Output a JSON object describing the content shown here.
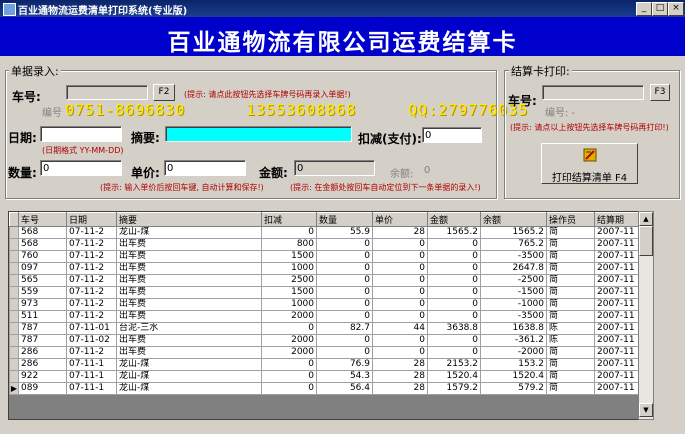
{
  "window": {
    "title": "百业通物流运费清单打印系统(专业版)",
    "controls": [
      "_",
      "□",
      "×"
    ]
  },
  "banner": {
    "heading": "百业通物流有限公司运费结算卡"
  },
  "entry": {
    "legend": "单据录入:",
    "plate_label": "车号:",
    "plate_value": "",
    "f2_button": "F2",
    "plate_hint": "(提示: 请点此按钮先选择车牌号码再录入单据!)",
    "serial_label": "编号",
    "date_label": "日期:",
    "date_value": "",
    "date_format": "(日期格式 YY-MM-DD)",
    "summary_label": "摘要:",
    "summary_value": "",
    "deduct_label": "扣减(支付):",
    "deduct_value": "0",
    "qty_label": "数量:",
    "qty_value": "0",
    "price_label": "单价:",
    "price_value": "0",
    "amount_label": "金额:",
    "amount_value": "0",
    "balance_label": "余额:",
    "balance_value": "0",
    "hint_enter": "(提示: 输入单价后按回车键, 自动计算和保存!)",
    "hint_cursor": "(提示: 在金额处按回车自动定位到下一条单据的录入!)"
  },
  "watermark": {
    "phone": "0751-8696830",
    "mobile": "13553608868",
    "qq": "QQ:279776035"
  },
  "print": {
    "legend": "结算卡打印:",
    "plate_label": "车号:",
    "plate_value": "",
    "f3_button": "F3",
    "serial_label": "编号: -",
    "hint": "(提示: 请点以上按钮先选择车牌号码再打印!)",
    "button_label": "打印结算清单 F4"
  },
  "table": {
    "columns": [
      "车号",
      "日期",
      "摘要",
      "扣减",
      "数量",
      "单价",
      "金额",
      "余额",
      "操作员",
      "结算期"
    ],
    "rows": [
      [
        "568",
        "07-11-2",
        "龙山-煤",
        "0",
        "55.9",
        "28",
        "1565.2",
        "1565.2",
        "简",
        "2007-11"
      ],
      [
        "568",
        "07-11-2",
        "出车费",
        "800",
        "0",
        "0",
        "0",
        "765.2",
        "简",
        "2007-11"
      ],
      [
        "760",
        "07-11-2",
        "出车费",
        "1500",
        "0",
        "0",
        "0",
        "-3500",
        "简",
        "2007-11"
      ],
      [
        "097",
        "07-11-2",
        "出车费",
        "1000",
        "0",
        "0",
        "0",
        "2647.8",
        "简",
        "2007-11"
      ],
      [
        "565",
        "07-11-2",
        "出车费",
        "2500",
        "0",
        "0",
        "0",
        "-2500",
        "简",
        "2007-11"
      ],
      [
        "559",
        "07-11-2",
        "出车费",
        "1500",
        "0",
        "0",
        "0",
        "-1500",
        "简",
        "2007-11"
      ],
      [
        "973",
        "07-11-2",
        "出车费",
        "1000",
        "0",
        "0",
        "0",
        "-1000",
        "简",
        "2007-11"
      ],
      [
        "511",
        "07-11-2",
        "出车费",
        "2000",
        "0",
        "0",
        "0",
        "-3500",
        "简",
        "2007-11"
      ],
      [
        "787",
        "07-11-01",
        "台泥-三水",
        "0",
        "82.7",
        "44",
        "3638.8",
        "1638.8",
        "陈",
        "2007-11"
      ],
      [
        "787",
        "07-11-02",
        "出车费",
        "2000",
        "0",
        "0",
        "0",
        "-361.2",
        "陈",
        "2007-11"
      ],
      [
        "286",
        "07-11-2",
        "出车费",
        "2000",
        "0",
        "0",
        "0",
        "-2000",
        "简",
        "2007-11"
      ],
      [
        "286",
        "07-11-1",
        "龙山-煤",
        "0",
        "76.9",
        "28",
        "2153.2",
        "153.2",
        "简",
        "2007-11"
      ],
      [
        "922",
        "07-11-1",
        "龙山-煤",
        "0",
        "54.3",
        "28",
        "1520.4",
        "1520.4",
        "简",
        "2007-11"
      ],
      [
        "089",
        "07-11-1",
        "龙山-煤",
        "0",
        "56.4",
        "28",
        "1579.2",
        "579.2",
        "简",
        "2007-11"
      ]
    ]
  }
}
